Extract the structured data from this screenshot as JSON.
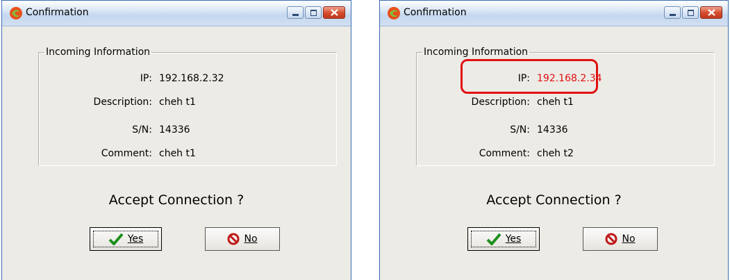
{
  "colors": {
    "highlight_red": "#e11010",
    "ip_changed_red": "#e01010"
  },
  "windows": [
    {
      "title": "Confirmation",
      "group_label": "Incoming Information",
      "fields": [
        {
          "label": "IP:",
          "value": "192.168.2.32"
        },
        {
          "label": "Description:",
          "value": "cheh t1"
        },
        {
          "label": "S/N:",
          "value": "14336"
        },
        {
          "label": "Comment:",
          "value": "cheh t1"
        }
      ],
      "question": "Accept Connection ?",
      "yes_label": "Yes",
      "no_label": "No"
    },
    {
      "title": "Confirmation",
      "group_label": "Incoming Information",
      "fields": [
        {
          "label": "IP:",
          "value": "192.168.2.34"
        },
        {
          "label": "Description:",
          "value": "cheh t1"
        },
        {
          "label": "S/N:",
          "value": "14336"
        },
        {
          "label": "Comment:",
          "value": "cheh t2"
        }
      ],
      "question": "Accept Connection ?",
      "yes_label": "Yes",
      "no_label": "No"
    }
  ]
}
